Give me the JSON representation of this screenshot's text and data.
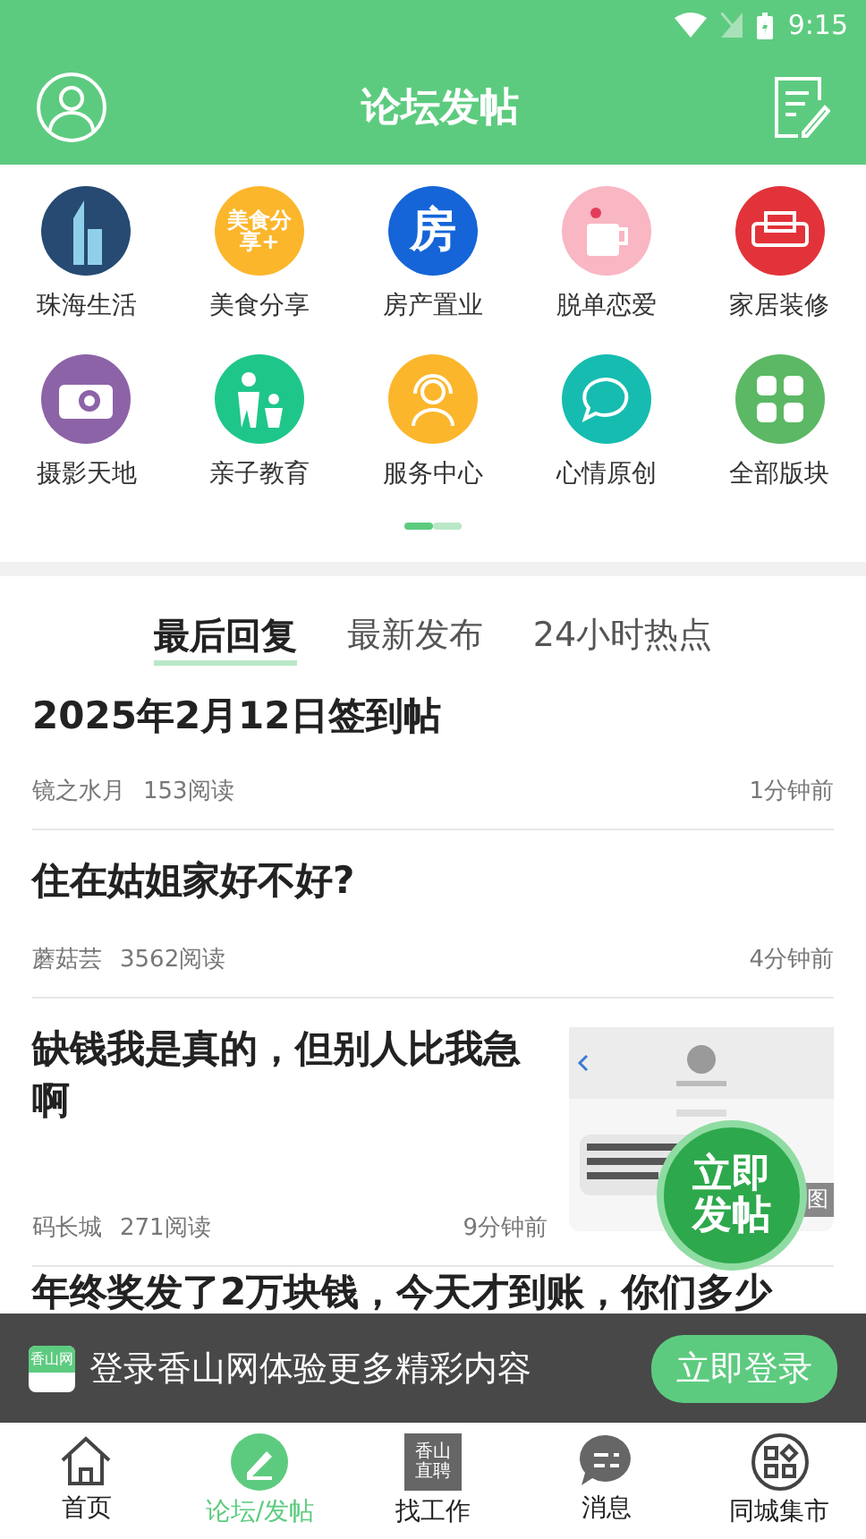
{
  "status_bar": {
    "time": "9:15"
  },
  "header": {
    "title": "论坛发帖"
  },
  "categories": [
    {
      "name": "珠海生活",
      "color": "#264a72",
      "kind": "city"
    },
    {
      "name": "美食分享",
      "color": "#fbb62c",
      "kind": "food",
      "icon_text": "美食分享+"
    },
    {
      "name": "房产置业",
      "color": "#1565d8",
      "kind": "house",
      "icon_text": "房"
    },
    {
      "name": "脱单恋爱",
      "color": "#f9b6c3",
      "kind": "cup"
    },
    {
      "name": "家居装修",
      "color": "#e2333a",
      "kind": "sofa"
    },
    {
      "name": "摄影天地",
      "color": "#8d63a8",
      "kind": "camera"
    },
    {
      "name": "亲子教育",
      "color": "#1fc68a",
      "kind": "family"
    },
    {
      "name": "服务中心",
      "color": "#fbb62c",
      "kind": "headset"
    },
    {
      "name": "心情原创",
      "color": "#16bcb0",
      "kind": "chat"
    },
    {
      "name": "全部版块",
      "color": "#5cb865",
      "kind": "grid"
    }
  ],
  "pages": [
    {
      "selected": true
    },
    {
      "selected": false
    }
  ],
  "tabs": [
    {
      "label": "最后回复",
      "selected": true
    },
    {
      "label": "最新发布",
      "selected": false
    },
    {
      "label": "24小时热点",
      "selected": false
    }
  ],
  "posts": [
    {
      "title": "2025年2月12日签到帖",
      "author": "镜之水月",
      "reads": "153阅读",
      "time": "1分钟前"
    },
    {
      "title": "住在姑姐家好不好?",
      "author": "蘑菇芸",
      "reads": "3562阅读",
      "time": "4分钟前"
    },
    {
      "title": "缺钱我是真的，但别人比我急啊",
      "author": "码长城",
      "reads": "271阅读",
      "time": "9分钟前",
      "thumbnail": {
        "kind": "picture",
        "tag": "图"
      }
    },
    {
      "title": "年终奖发了2万块钱，今天才到账，你们多少"
    }
  ],
  "float_button": {
    "lines": [
      "立即",
      "发帖"
    ]
  },
  "login_banner": {
    "logo_text": "香山网",
    "text": "登录香山网体验更多精彩内容",
    "button": "立即登录"
  },
  "nav": [
    {
      "label": "首页",
      "kind": "home",
      "selected": false
    },
    {
      "label": "论坛/发帖",
      "kind": "pencil",
      "selected": true
    },
    {
      "label": "找工作",
      "kind": "jobs",
      "selected": false,
      "icon_lines": [
        "香山",
        "直聘"
      ]
    },
    {
      "label": "消息",
      "kind": "message",
      "selected": false
    },
    {
      "label": "同城集市",
      "kind": "market",
      "selected": false
    }
  ]
}
